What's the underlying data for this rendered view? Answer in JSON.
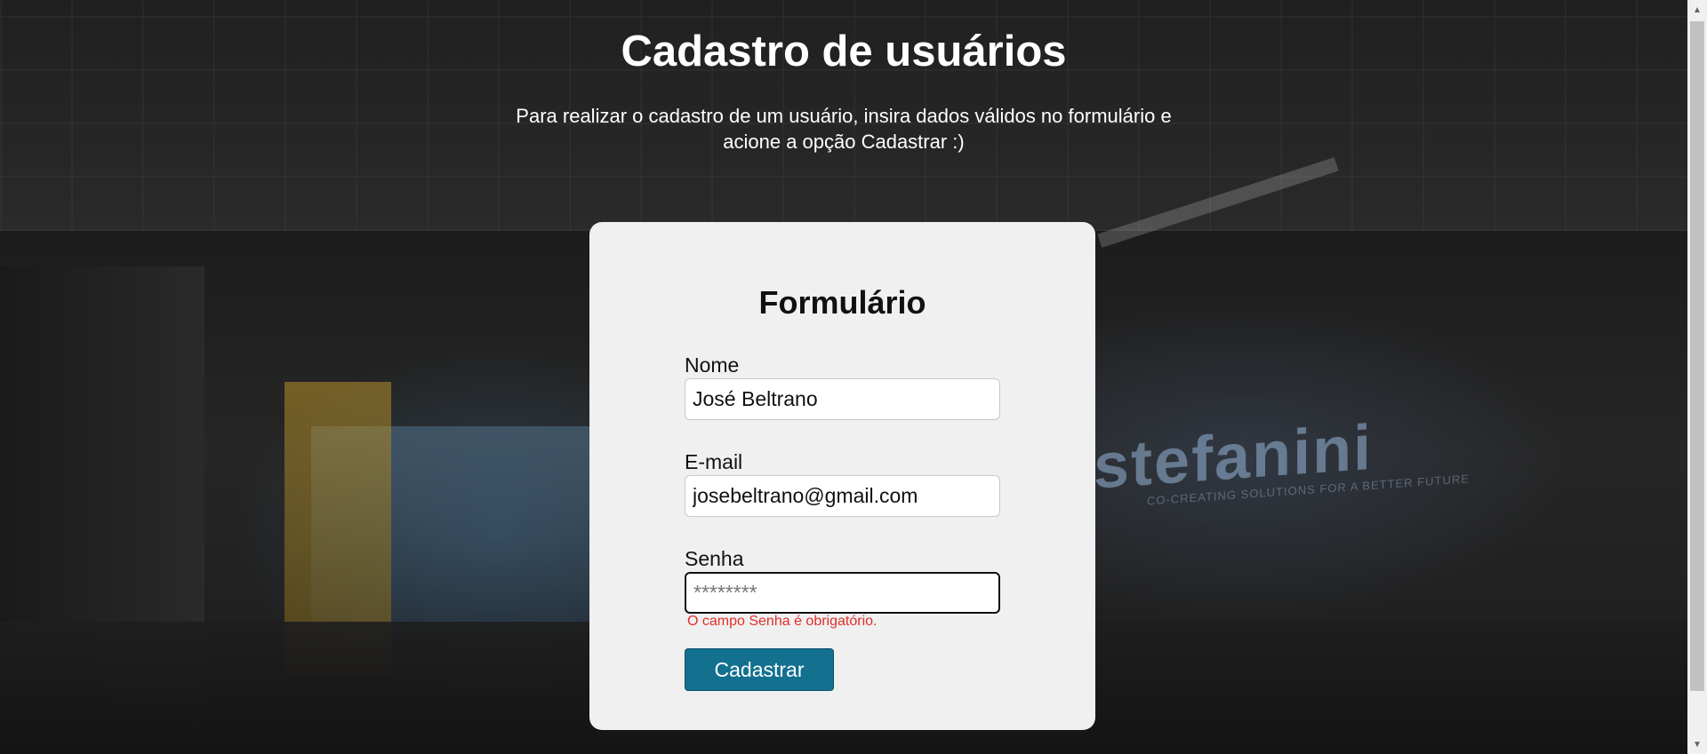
{
  "header": {
    "title": "Cadastro de usuários",
    "subtitle": "Para realizar o cadastro de um usuário, insira dados válidos no formulário e acione a opção Cadastrar :)"
  },
  "form": {
    "title": "Formulário",
    "fields": [
      {
        "label": "Nome",
        "value": "José Beltrano",
        "placeholder": ""
      },
      {
        "label": "E-mail",
        "value": "josebeltrano@gmail.com",
        "placeholder": ""
      },
      {
        "label": "Senha",
        "value": "",
        "placeholder": "********"
      }
    ],
    "error": "O campo Senha é obrigatório.",
    "submit_label": "Cadastrar"
  },
  "background": {
    "logo_text": "stefanini",
    "logo_tagline": "CO-CREATING SOLUTIONS FOR A BETTER FUTURE"
  },
  "colors": {
    "button": "#13708f",
    "error": "#e0302a",
    "card": "#f0f0f0"
  },
  "icons": {
    "scroll_up": "scroll-up-arrow-icon",
    "scroll_down": "scroll-down-arrow-icon"
  }
}
